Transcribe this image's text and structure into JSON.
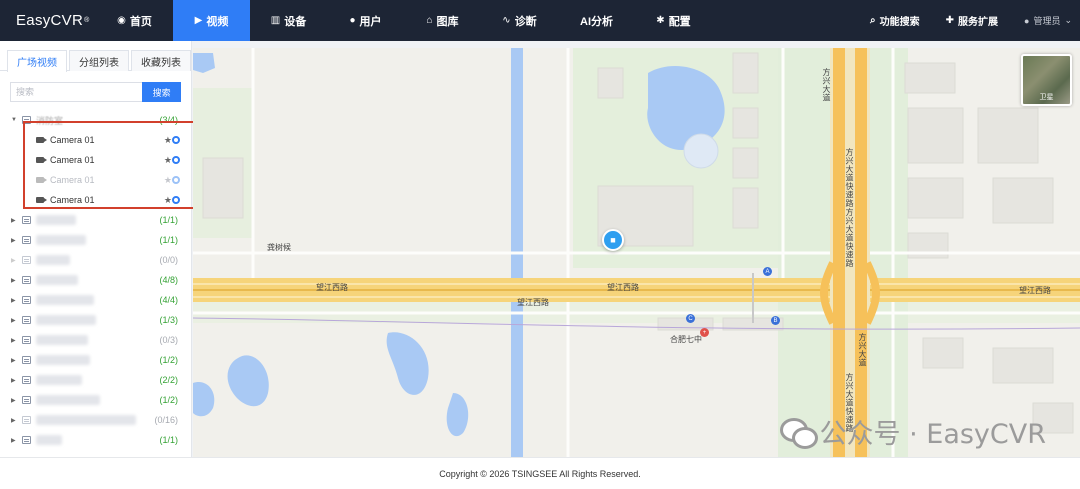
{
  "app": {
    "brand": "EasyCVR",
    "brand_mark": "®"
  },
  "nav": {
    "items": [
      {
        "label": "首页",
        "icon": "dashboard-icon"
      },
      {
        "label": "视频",
        "icon": "play-circle-icon",
        "active": true
      },
      {
        "label": "设备",
        "icon": "device-icon"
      },
      {
        "label": "用户",
        "icon": "user-icon"
      },
      {
        "label": "图库",
        "icon": "bank-icon"
      },
      {
        "label": "诊断",
        "icon": "pulse-icon"
      },
      {
        "label": "AI分析",
        "icon": ""
      },
      {
        "label": "配置",
        "icon": "gear-icon"
      }
    ],
    "right": {
      "search": "功能搜索",
      "ext": "服务扩展",
      "user": "管理员"
    }
  },
  "sidebar": {
    "tabs": [
      "广场视频",
      "分组列表",
      "收藏列表"
    ],
    "search_placeholder": "搜索",
    "search_button": "搜索",
    "groups": [
      {
        "name": "消防室",
        "count": "(3/4)",
        "expanded": true,
        "cameras": [
          {
            "name": "Camera 01",
            "online": true
          },
          {
            "name": "Camera 01",
            "online": true
          },
          {
            "name": "Camera 01",
            "online": false
          },
          {
            "name": "Camera 01",
            "online": true
          }
        ]
      },
      {
        "count": "(1/1)",
        "online": true
      },
      {
        "count": "(1/1)",
        "online": true
      },
      {
        "count": "(0/0)",
        "online": false
      },
      {
        "count": "(4/8)",
        "online": true
      },
      {
        "count": "(4/4)",
        "online": true
      },
      {
        "count": "(1/3)",
        "online": true
      },
      {
        "count": "(0/3)",
        "online": false
      },
      {
        "count": "(1/2)",
        "online": true
      },
      {
        "count": "(2/2)",
        "online": true
      },
      {
        "count": "(1/2)",
        "online": true
      },
      {
        "count": "(0/16)",
        "online": false
      },
      {
        "count": "(1/1)",
        "online": true
      }
    ]
  },
  "map": {
    "sat_label": "卫星",
    "labels": {
      "road1": "望江西路",
      "road2": "望江西路",
      "road3": "望江西路",
      "road4": "望江西路",
      "school": "合肥七中",
      "village": "龚树候",
      "ave1": "方兴大道",
      "ave2": "方兴大道快速路",
      "ave3": "方兴大道快速路",
      "ave4": "方兴大道",
      "ave5": "方兴大道快速路"
    },
    "poi_a": "A",
    "poi_b": "B",
    "poi_c": "C"
  },
  "watermark": "公众号 · EasyCVR",
  "footer": "Copyright © 2026 TSINGSEE All Rights Reserved."
}
